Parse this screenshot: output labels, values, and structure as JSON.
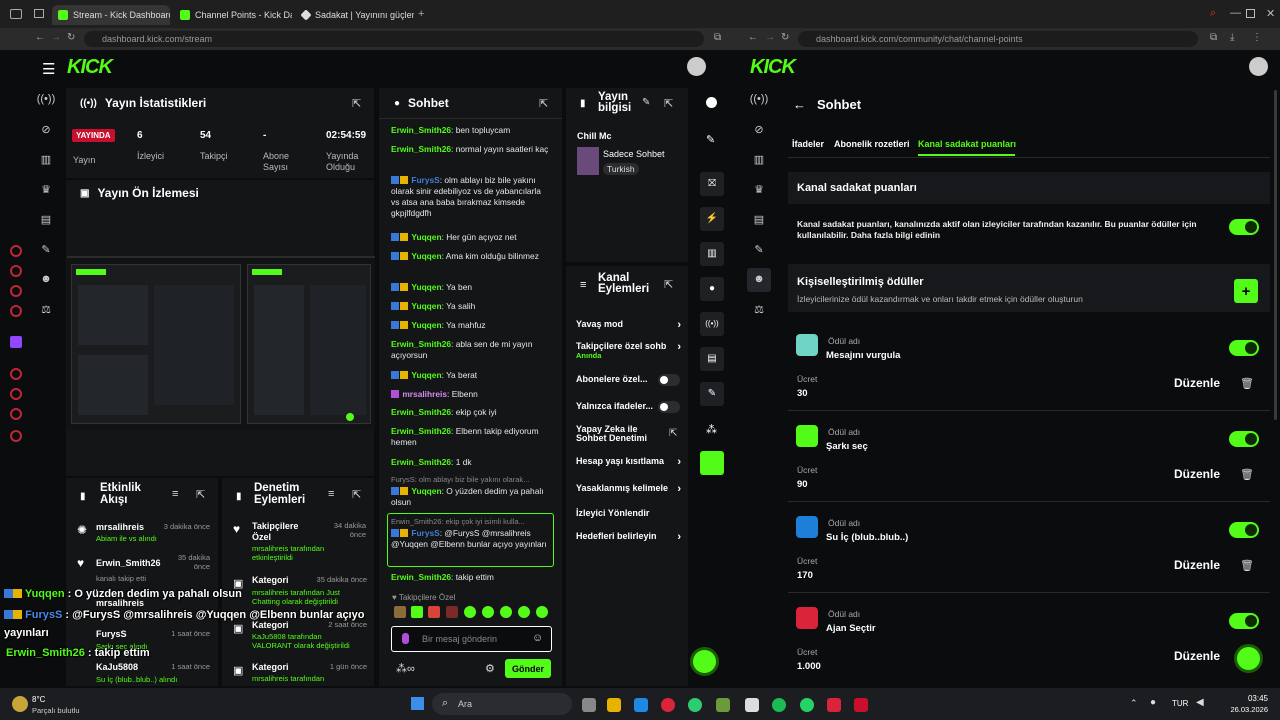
{
  "browser": {
    "tabs": [
      {
        "label": "Stream - Kick Dashboard",
        "active": true
      },
      {
        "label": "Channel Points - Kick Da",
        "active": false
      },
      {
        "label": "Sadakat | Yayınını güçlend",
        "active": false
      }
    ],
    "left_url": "dashboard.kick.com/stream",
    "right_url": "dashboard.kick.com/community/chat/channel-points"
  },
  "stats": {
    "title": "Yayın İstatistikleri",
    "live_badge": "YAYINDA",
    "live_label": "Yayın",
    "viewers": "6",
    "viewers_label": "İzleyici",
    "followers": "54",
    "followers_label": "Takipçi",
    "subs": "-",
    "subs_label": "Abone Sayısı",
    "uptime": "02:54:59",
    "uptime_label": "Yayında Olduğu"
  },
  "preview": {
    "title": "Yayın Ön İzlemesi"
  },
  "activity": {
    "title": "Etkinlik Akışı",
    "items": [
      {
        "name": "mrsalihreis",
        "sub": "Abiam ile vs alındı",
        "time": "3 dakika önce"
      },
      {
        "name": "Erwin_Smith26",
        "sub": "kanalı takip etti",
        "time": "35 dakika önce"
      },
      {
        "name": "mrsalihreis",
        "sub": "",
        "time": ""
      },
      {
        "name": "FurysS",
        "sub": "Şarkı seç alındı",
        "time": "1 saat önce"
      },
      {
        "name": "KaJu5808",
        "sub": "Su İç (blub..blub..) alındı",
        "time": "1 saat önce"
      }
    ]
  },
  "moderation": {
    "title": "Denetim Eylemleri",
    "items": [
      {
        "name": "Takipçilere Özel",
        "sub": "mrsalihreis tarafından etkinleştirildi",
        "time": "34 dakika önce"
      },
      {
        "name": "Kategori",
        "sub": "mrsalihreis tarafından Just Chatting olarak değiştirildi",
        "time": "35 dakika önce"
      },
      {
        "name": "Kategori",
        "sub": "KaJu5808 tarafından VALORANT olarak değiştirildi",
        "time": "2 saat önce"
      },
      {
        "name": "Kategori",
        "sub": "mrsalihreis tarafından",
        "time": "1 gün önce"
      }
    ]
  },
  "chat": {
    "title": "Sohbet",
    "messages": [
      {
        "user": "Erwin_Smith26",
        "text": "ben topluycam"
      },
      {
        "user": "Erwin_Smith26",
        "text": "normal yayın saatleri kaç"
      },
      {
        "user": "FurysS",
        "text": "olm ablayı biz bile yakını olarak sinir edebiliyoz vs de yabancılarla vs atsa ana baba bırakmaz kimsede gkpjlfdgdfh"
      },
      {
        "user": "Yuqqen",
        "text": "Her gün açıyoz net"
      },
      {
        "user": "Yuqqen",
        "text": "Ama kim olduğu bilinmez"
      },
      {
        "user": "Yuqqen",
        "text": "Ya ben"
      },
      {
        "user": "Yuqqen",
        "text": "Ya salih"
      },
      {
        "user": "Yuqqen",
        "text": "Ya mahfuz"
      },
      {
        "user": "Erwin_Smith26",
        "text": "abla sen de mi yayın açıyorsun"
      },
      {
        "user": "Yuqqen",
        "text": "Ya berat"
      },
      {
        "user": "mrsalihreis",
        "text": "Elbenn"
      },
      {
        "user": "Erwin_Smith26",
        "text": "ekip çok iyi"
      },
      {
        "user": "Erwin_Smith26",
        "text": "Elbenn takip ediyorum hemen"
      },
      {
        "user": "Erwin_Smith26",
        "text": "1 dk"
      },
      {
        "reply": "FurysS: olm ablayı biz bile yakını olarak...",
        "user": "Yuqqen",
        "text": "O yüzden dedim ya pahalı olsun"
      },
      {
        "reply": "Erwin_Smith26: ekip çok iyi isimli kulla...",
        "user": "FurysS",
        "text": "@FurysS @mrsalihreis @Yuqqen @Elbenn bunlar açıyo yayınları"
      },
      {
        "user": "Erwin_Smith26",
        "text": "takip ettim"
      }
    ],
    "followers_only": "Takipçilere Özel",
    "input_placeholder": "Bir mesaj gönderin",
    "send_label": "Gönder"
  },
  "stream_info": {
    "title": "Yayın bilgisi",
    "stream_title": "Chill Mc",
    "category": "Sadece Sohbet",
    "language": "Turkish"
  },
  "channel_actions": {
    "title": "Kanal Eylemleri",
    "items": [
      {
        "label": "Yavaş mod",
        "sub": ""
      },
      {
        "label": "Takipçilere özel sohb",
        "sub": "Anında"
      },
      {
        "label": "Abonelere özel...",
        "sub": ""
      },
      {
        "label": "Yalnızca ifadeler...",
        "sub": ""
      },
      {
        "label": "Yapay Zeka ile Sohbet Denetimi",
        "sub": ""
      },
      {
        "label": "Hesap yaşı kısıtlama",
        "sub": ""
      },
      {
        "label": "Yasaklanmış kelimele",
        "sub": ""
      },
      {
        "label": "İzleyici Yönlendir",
        "sub": ""
      },
      {
        "label": "Hedefleri belirleyin",
        "sub": ""
      }
    ]
  },
  "points_page": {
    "back_title": "Sohbet",
    "tabs": [
      "İfadeler",
      "Abonelik rozetleri",
      "Kanal sadakat puanları"
    ],
    "section_title": "Kanal sadakat puanları",
    "description": "Kanal sadakat puanları, kanalınızda aktif olan izleyiciler tarafından kazanılır. Bu puanlar ödüller için kullanılabilir. Daha fazla bilgi edinin",
    "custom_title": "Kişiselleştirilmiş ödüller",
    "custom_sub": "İzleyicilerinize ödül kazandırmak ve onları takdir etmek için ödüller oluşturun",
    "reward_label": "Ödül adı",
    "cost_label": "Ücret",
    "edit_label": "Düzenle",
    "rewards": [
      {
        "name": "Mesajını vurgula",
        "cost": "30",
        "color": "#6fd3c6"
      },
      {
        "name": "Şarkı seç",
        "cost": "90",
        "color": "#53fc18"
      },
      {
        "name": "Su İç (blub..blub..)",
        "cost": "170",
        "color": "#1e7fd8"
      },
      {
        "name": "Ajan Seçtir",
        "cost": "1.000",
        "color": "#d9243a"
      }
    ]
  },
  "overlay": {
    "line1_user": "Yuqqen",
    "line1_text": "O yüzden dedim ya pahalı olsun",
    "line2_user": "FurysS",
    "line2_text": "@FurysS @mrsalihreis @Yuqqen @Elbenn bunlar açıyo",
    "line2_cont": "yayınları",
    "line3_user": "Erwin_Smith26",
    "line3_text": "takip ettim"
  },
  "taskbar": {
    "weather_temp": "8°C",
    "weather_desc": "Parçalı bulutlu",
    "search": "Ara",
    "lang": "TUR",
    "time": "03:45",
    "date": "26.03.2026"
  },
  "colors": {
    "kick_green": "#53fc18",
    "live_red": "#c8102e",
    "bg": "#0b0c0d"
  }
}
